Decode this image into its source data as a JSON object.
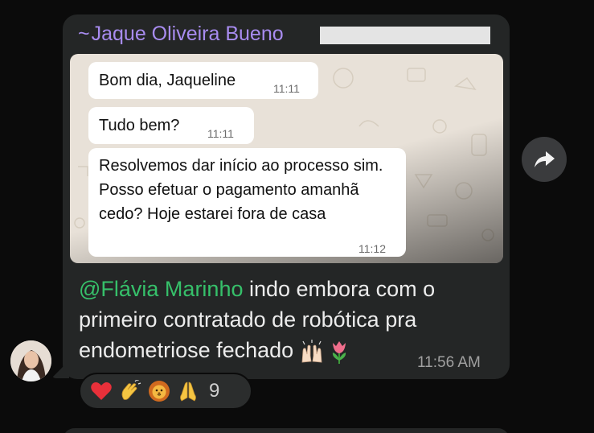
{
  "message": {
    "sender_prefix": "~",
    "sender_name": "Jaque Oliveira Bueno",
    "embedded_screenshot": {
      "messages": [
        {
          "text": "Bom dia, Jaqueline",
          "time": "11:11"
        },
        {
          "text": "Tudo bem?",
          "time": "11:11"
        },
        {
          "text": "Resolvemos dar início ao processo sim. Posso efetuar o pagamento amanhã cedo? Hoje estarei fora de casa",
          "time": "11:12"
        }
      ]
    },
    "caption": {
      "mention": "@Flávia Marinho",
      "text": " indo embora com o primeiro contratado de robótica pra endometriose fechado",
      "emojis": [
        "raising-hands",
        "tulip"
      ]
    },
    "time": "11:56 AM"
  },
  "reactions": {
    "emojis": [
      "heart",
      "clapping-hands",
      "lion",
      "folded-hands"
    ],
    "count": "9"
  },
  "colors": {
    "background": "#0b0b0b",
    "bubble": "#242626",
    "sender": "#a88cf0",
    "mention": "#36c06a",
    "text": "#ececec",
    "timestamp": "#a0a0a0"
  }
}
